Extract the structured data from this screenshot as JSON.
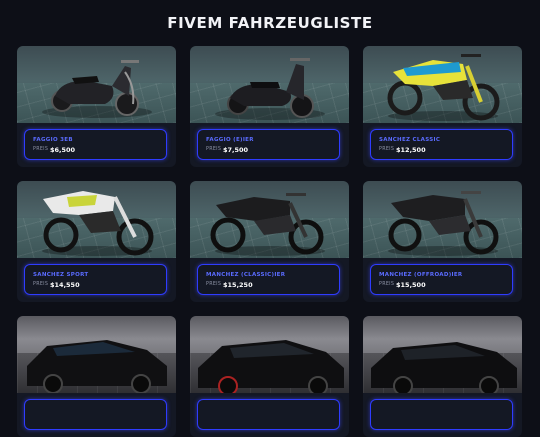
{
  "page": {
    "title": "FIVEM FAHRZEUGLISTE"
  },
  "price_label": "PREIS",
  "vehicles": [
    {
      "name": "FAGGIO 3EB",
      "price": "$6,500",
      "kind": "scooter-vintage"
    },
    {
      "name": "FAGGIO (E)IER",
      "price": "$7,500",
      "kind": "scooter-modern"
    },
    {
      "name": "SANCHEZ CLASSIC",
      "price": "$12,500",
      "kind": "dirtbike-yellow"
    },
    {
      "name": "SANCHEZ SPORT",
      "price": "$14,550",
      "kind": "dirtbike-white"
    },
    {
      "name": "MANCHEZ (CLASSIC)IER",
      "price": "$15,250",
      "kind": "motocross-black"
    },
    {
      "name": "MANCHEZ (OFFROAD)IER",
      "price": "$15,500",
      "kind": "offroad-black"
    },
    {
      "name": "",
      "price": "",
      "kind": "sedan-classic"
    },
    {
      "name": "",
      "price": "",
      "kind": "sedan-modern"
    },
    {
      "name": "",
      "price": "",
      "kind": "sedan-sport"
    }
  ],
  "colors": {
    "accent": "#2f3cff",
    "name_text": "#5a6bff",
    "background": "#0d0f17",
    "card": "#141824"
  }
}
